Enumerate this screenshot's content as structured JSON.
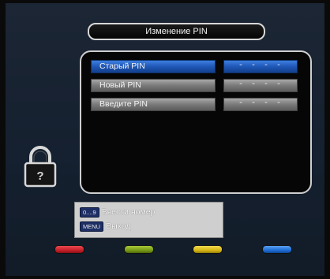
{
  "title": "Изменение PIN",
  "rows": [
    {
      "label": "Старый PIN",
      "value": "- - - -"
    },
    {
      "label": "Новый PIN",
      "value": "- - - -"
    },
    {
      "label": "Введите PIN",
      "value": "- - - -"
    }
  ],
  "help": [
    {
      "key": "0....9",
      "text": "Ввести номер"
    },
    {
      "key": "MENU",
      "text": "Выход"
    }
  ],
  "color_buttons": [
    {
      "name": "red",
      "color": "#c8202a"
    },
    {
      "name": "green",
      "color": "#7a9c18"
    },
    {
      "name": "yellow",
      "color": "#d8b818"
    },
    {
      "name": "blue",
      "color": "#1f6fd8"
    }
  ]
}
